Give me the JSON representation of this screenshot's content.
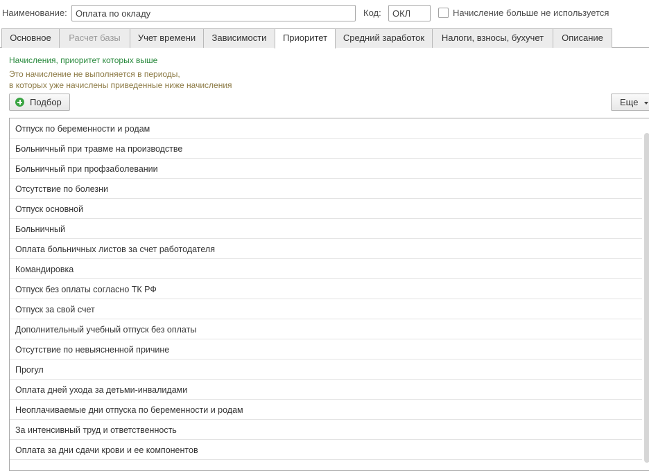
{
  "header": {
    "name_label": "Наименование:",
    "name_value": "Оплата по окладу",
    "code_label": "Код:",
    "code_value": "ОКЛ",
    "unused_label": "Начисление больше не используется"
  },
  "tabs": [
    {
      "label": "Основное",
      "state": "normal"
    },
    {
      "label": "Расчет базы",
      "state": "disabled"
    },
    {
      "label": "Учет времени",
      "state": "normal"
    },
    {
      "label": "Зависимости",
      "state": "normal"
    },
    {
      "label": "Приоритет",
      "state": "active"
    },
    {
      "label": "Средний заработок",
      "state": "normal"
    },
    {
      "label": "Налоги, взносы, бухучет",
      "state": "normal"
    },
    {
      "label": "Описание",
      "state": "normal"
    }
  ],
  "section": {
    "heading": "Начисления, приоритет которых выше",
    "note_line1": "Это начисление не выполняется в периоды,",
    "note_line2": "в которых уже начислены приведенные ниже начисления"
  },
  "toolbar": {
    "pick_label": "Подбор",
    "more_label": "Еще"
  },
  "list": [
    "Отпуск по беременности и родам",
    "Больничный при травме на производстве",
    "Больничный при профзаболевании",
    "Отсутствие по болезни",
    "Отпуск основной",
    "Больничный",
    "Оплата больничных листов за счет работодателя",
    "Командировка",
    "Отпуск без оплаты согласно ТК РФ",
    "Отпуск за свой счет",
    "Дополнительный учебный отпуск без оплаты",
    "Отсутствие по невыясненной причине",
    "Прогул",
    "Оплата дней ухода за детьми-инвалидами",
    "Неоплачиваемые дни отпуска по беременности и родам",
    "За интенсивный труд и ответственность",
    "Оплата за дни сдачи крови и ее компонентов"
  ],
  "colors": {
    "heading_green": "#2a8a3e",
    "note_olive": "#8c7a45",
    "add_icon_green": "#3aa443"
  },
  "icons": {
    "pick_button": "plus-circle-icon",
    "more_button": "chevron-down-icon"
  }
}
